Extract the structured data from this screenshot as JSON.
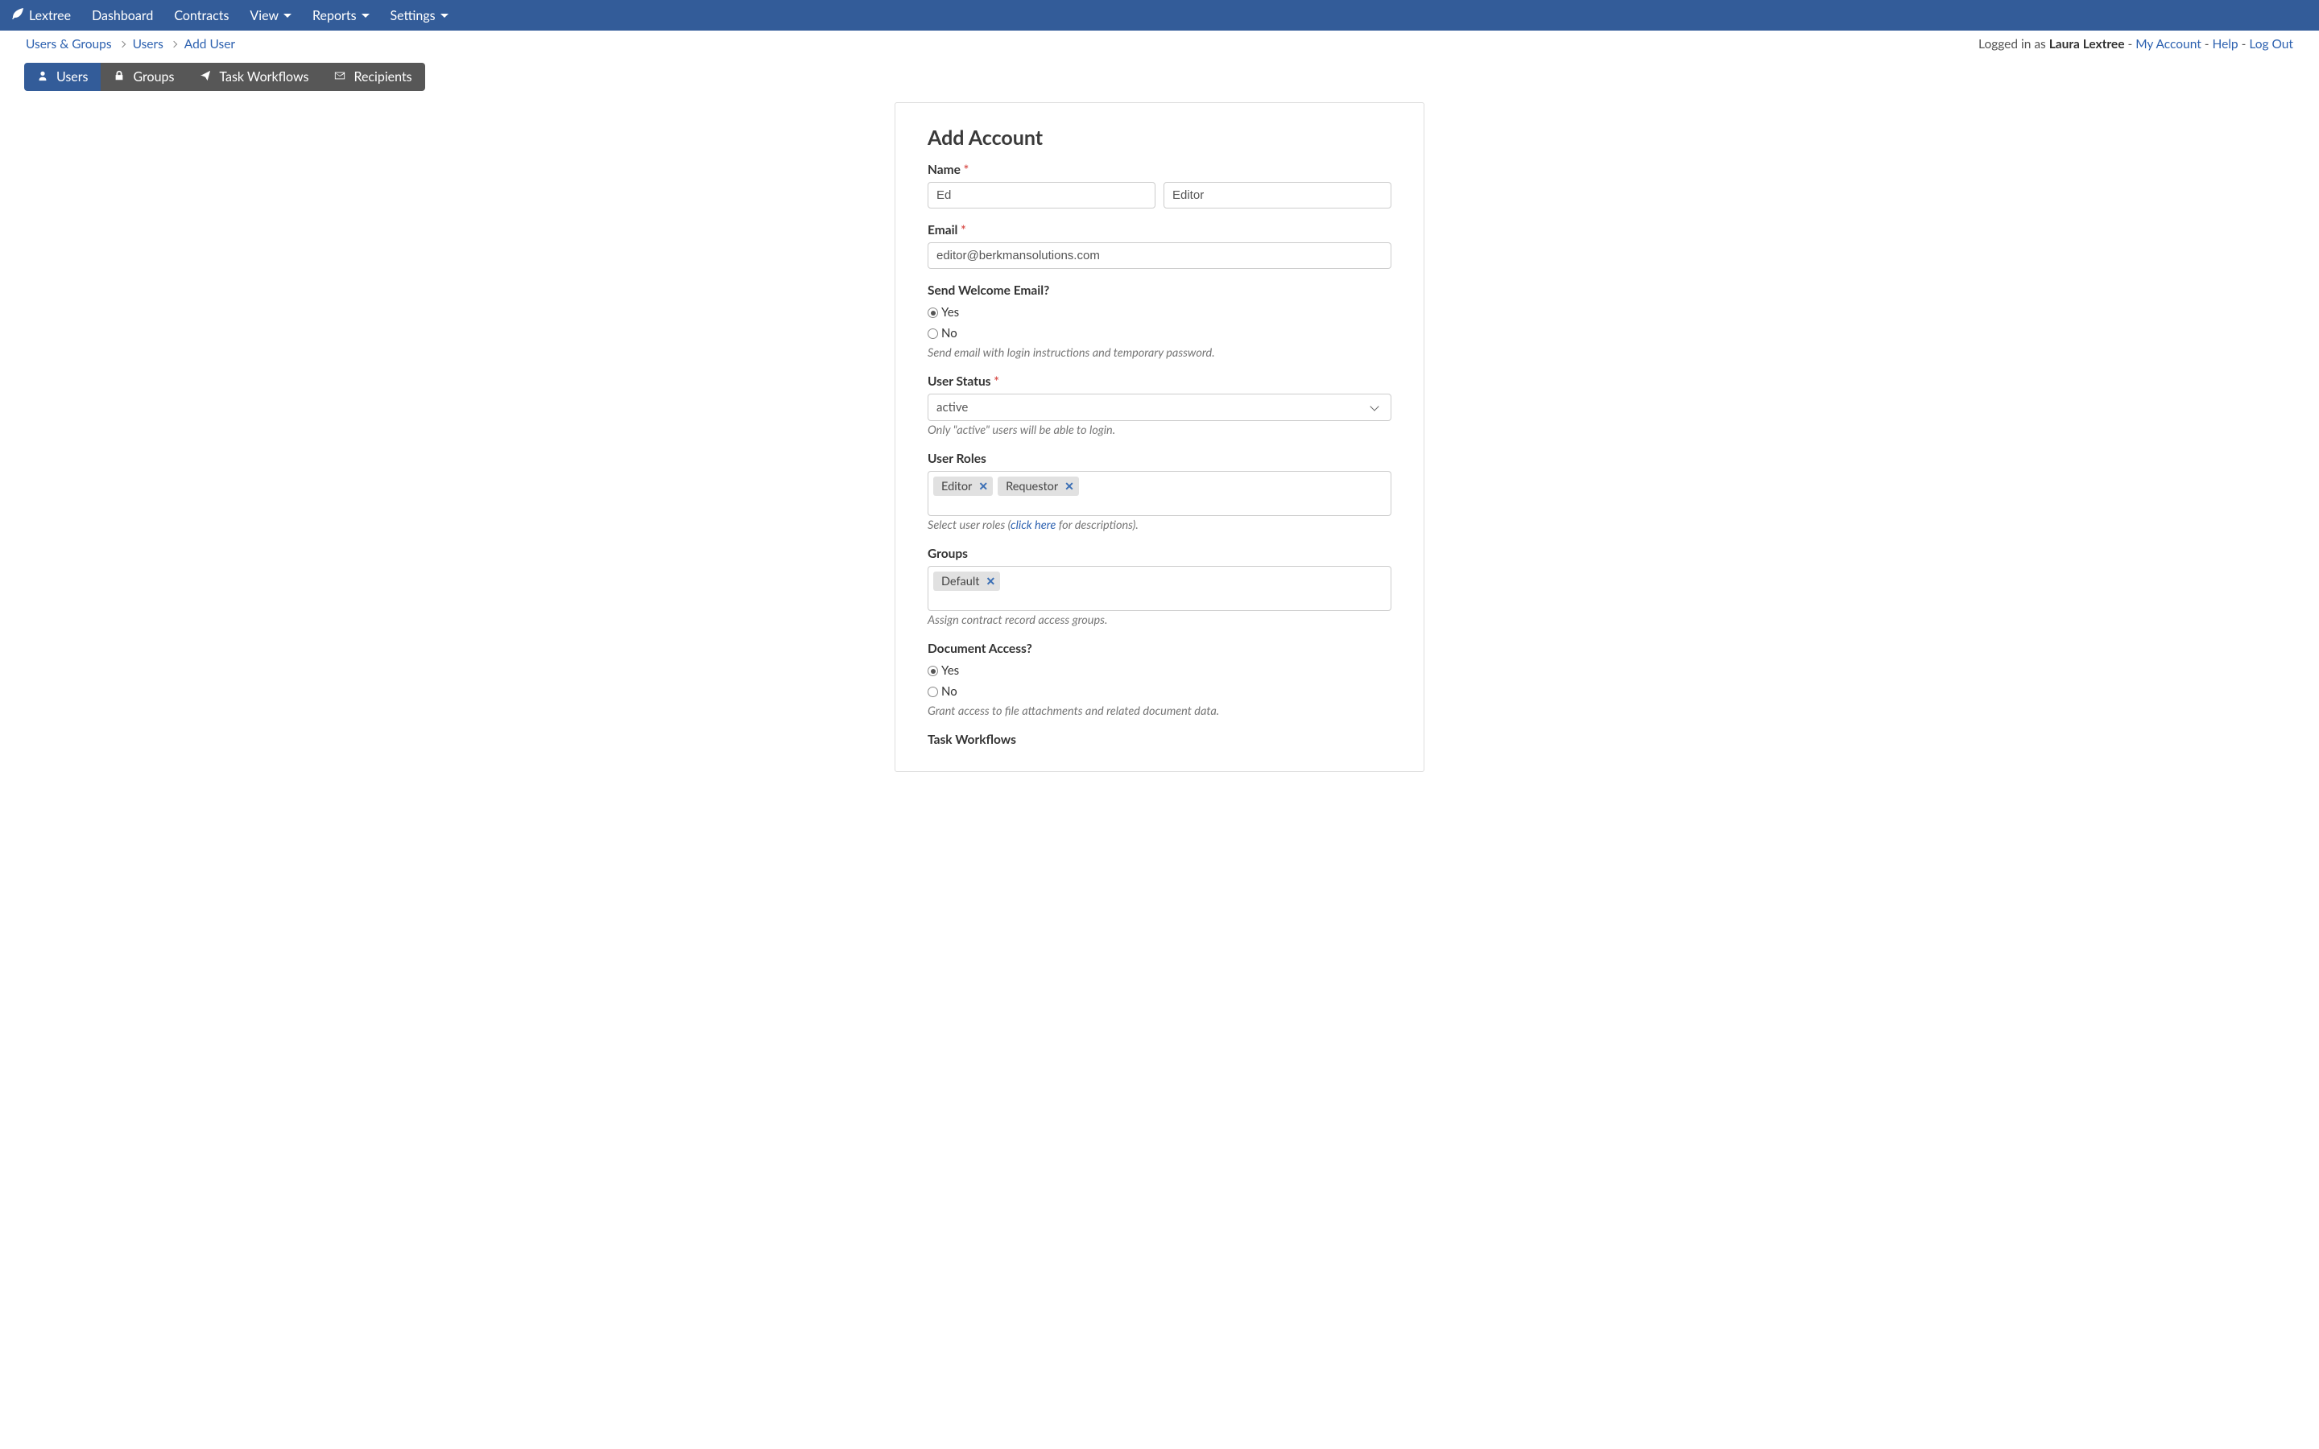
{
  "nav": {
    "brand": "Lextree",
    "items": [
      {
        "label": "Dashboard",
        "dropdown": false
      },
      {
        "label": "Contracts",
        "dropdown": false
      },
      {
        "label": "View",
        "dropdown": true
      },
      {
        "label": "Reports",
        "dropdown": true
      },
      {
        "label": "Settings",
        "dropdown": true
      }
    ]
  },
  "breadcrumbs": [
    "Users & Groups",
    "Users",
    "Add User"
  ],
  "userinfo": {
    "prefix": "Logged in as ",
    "name": "Laura Lextree",
    "sep": " - ",
    "my_account": "My Account",
    "help": "Help",
    "logout": "Log Out"
  },
  "tabs": [
    {
      "label": "Users",
      "active": true,
      "icon": "user"
    },
    {
      "label": "Groups",
      "active": false,
      "icon": "lock"
    },
    {
      "label": "Task Workflows",
      "active": false,
      "icon": "paper-plane"
    },
    {
      "label": "Recipients",
      "active": false,
      "icon": "envelope"
    }
  ],
  "form": {
    "title": "Add Account",
    "name_label": "Name",
    "first_name": "Ed",
    "last_name": "Editor",
    "email_label": "Email",
    "email": "editor@berkmansolutions.com",
    "welcome_label": "Send Welcome Email?",
    "yes": "Yes",
    "no": "No",
    "welcome_help": "Send email with login instructions and temporary password.",
    "status_label": "User Status",
    "status_value": "active",
    "status_help": "Only \"active\" users will be able to login.",
    "roles_label": "User Roles",
    "roles": [
      "Editor",
      "Requestor"
    ],
    "roles_help_1": "Select user roles (",
    "roles_help_link": "click here",
    "roles_help_2": " for descriptions).",
    "groups_label": "Groups",
    "groups": [
      "Default"
    ],
    "groups_help": "Assign contract record access groups.",
    "doc_label": "Document Access?",
    "doc_help": "Grant access to file attachments and related document data.",
    "workflows_label": "Task Workflows"
  }
}
